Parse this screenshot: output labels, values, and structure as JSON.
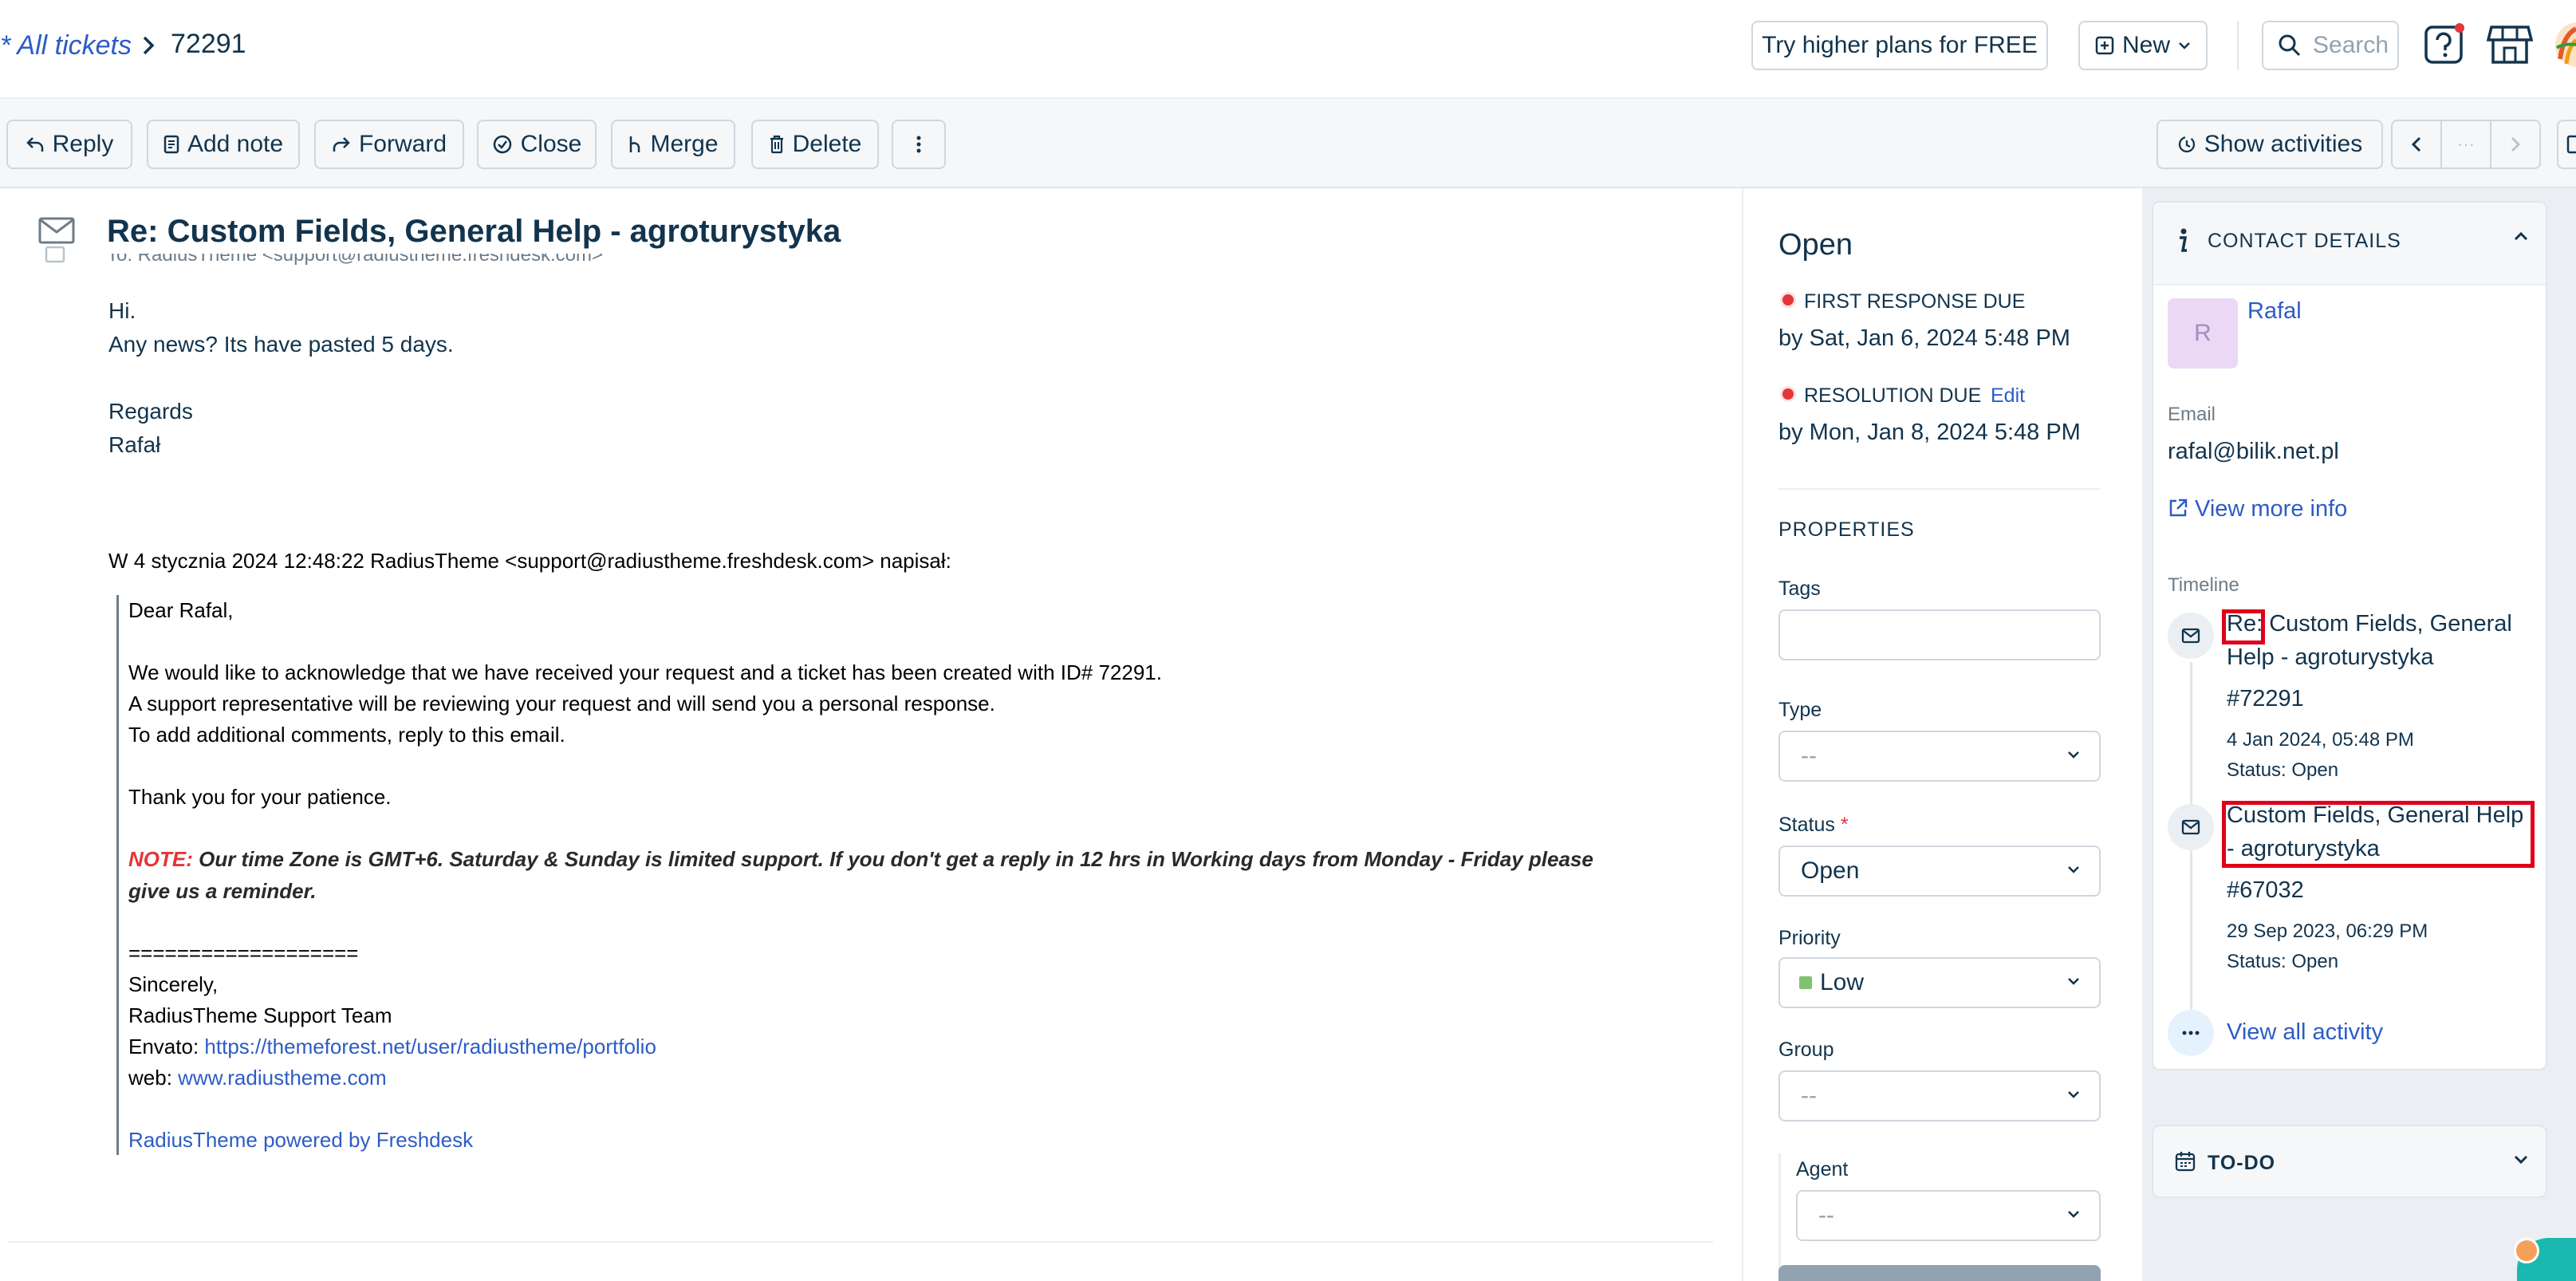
{
  "header": {
    "breadcrumb_link": "* All tickets",
    "ticket_id": "72291",
    "trial_button": "Try higher plans for FREE",
    "new_button": "New",
    "search_placeholder": "Search"
  },
  "toolbar": {
    "reply": "Reply",
    "add_note": "Add note",
    "forward": "Forward",
    "close": "Close",
    "merge": "Merge",
    "delete": "Delete",
    "show_activities": "Show activities",
    "nav_middle": "···"
  },
  "ticket": {
    "subject": "Re: Custom Fields, General Help - agroturystyka",
    "to_line": "To: RadiusTheme <support@radiustheme.freshdesk.com>",
    "body": {
      "greeting": "Hi.",
      "line1": "Any news? Its have pasted 5 days.",
      "regards": "Regards",
      "name": "Rafał",
      "quote_header": "W 4 stycznia 2024 12:48:22 RadiusTheme <support@radiustheme.freshdesk.com> napisał:"
    },
    "quote": {
      "dear": "Dear Rafal,",
      "p1": "We would like to acknowledge that we have received your request and a ticket has been created with ID# 72291.",
      "p2": "A support representative will be reviewing your request and will send you a personal response.",
      "p3": "To add additional comments, reply to this email.",
      "thanks": "Thank you for your patience.",
      "note_label": "NOTE:",
      "note_line1": " Our time Zone is GMT+6. Saturday & Sunday is limited support. If you don't get a reply in 12 hrs in Working days from Monday - Friday please",
      "note_line2": "give us a reminder.",
      "divider": "===================",
      "sincerely": "Sincerely,",
      "team": "RadiusTheme Support Team",
      "envato_label": "Envato: ",
      "envato_link": "https://themeforest.net/user/radiustheme/portfolio",
      "web_label": "web: ",
      "web_link": "www.radiustheme.com",
      "powered": "RadiusTheme powered by Freshdesk"
    }
  },
  "properties": {
    "status_heading": "Open",
    "first_response_label": "FIRST RESPONSE DUE",
    "first_response_value": "by Sat, Jan 6, 2024 5:48 PM",
    "resolution_label": "RESOLUTION DUE",
    "resolution_edit": "Edit",
    "resolution_value": "by Mon, Jan 8, 2024 5:48 PM",
    "section_title": "PROPERTIES",
    "tags_label": "Tags",
    "type_label": "Type",
    "type_value": "--",
    "status_label": "Status",
    "required_mark": "*",
    "status_value": "Open",
    "priority_label": "Priority",
    "priority_value": "Low",
    "group_label": "Group",
    "group_value": "--",
    "agent_label": "Agent",
    "agent_value": "--",
    "colors": {
      "due_red": "#e43538",
      "priority_low": "#7fc26f"
    }
  },
  "contact": {
    "section_title": "CONTACT DETAILS",
    "avatar_initial": "R",
    "name": "Rafal",
    "email_label": "Email",
    "email": "rafal@bilik.net.pl",
    "view_more": "View more info",
    "timeline_label": "Timeline",
    "timeline": [
      {
        "prefix": "Re:",
        "title_rest": " Custom Fields, General",
        "title_line2": "Help - agroturystyka",
        "ticket": "#72291",
        "date": "4 Jan 2024, 05:48 PM",
        "status": "Status: Open"
      },
      {
        "title_line1": "Custom Fields, General Help",
        "title_line2": "- agroturystyka",
        "ticket": "#67032",
        "date": "29 Sep 2023, 06:29 PM",
        "status": "Status: Open"
      }
    ],
    "view_all": "View all activity",
    "todo_title": "TO-DO"
  }
}
